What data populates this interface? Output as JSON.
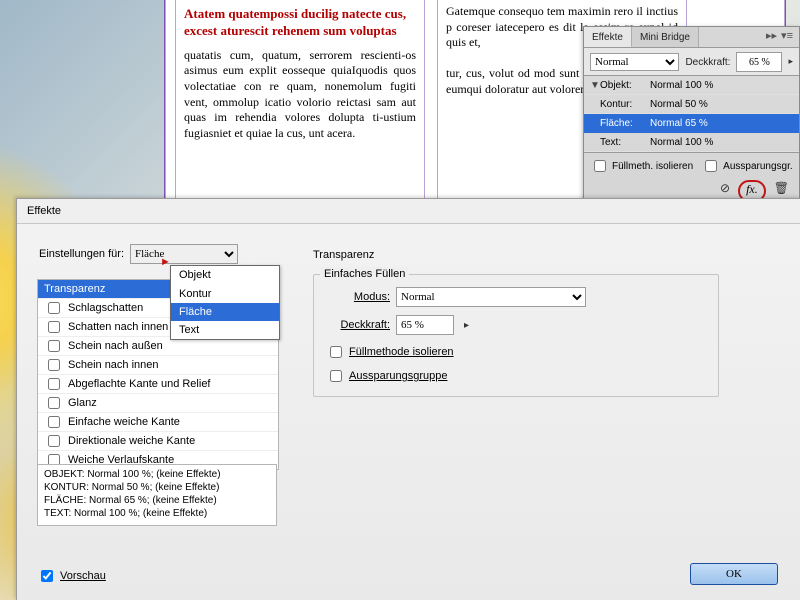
{
  "doc": {
    "heading": "Atatem quatempossi ducilig natecte cus, excest aturescit rehenem sum voluptas",
    "col1": "quatatis cum, quatum, serrorem rescienti-os asimus eum explit eosseque quiaIquodis quos volectatiae con re quam, nonemolum fugiti vent, ommolup icatio volorio reictasi sam aut quas im rehendia volores dolupta ti-ustium fugiasniet et quiae la cus, unt acera.",
    "col2": "Gatemque consequo tem maximin rero il inctius p coreser iatecepero es dit la essim re expel id quis et,\n\ntur, cus, volut od mod sunt veleseq uatio. Nam eumqui doloratur aut volorem in in eatem"
  },
  "panel": {
    "tab_active": "Effekte",
    "tab_other": "Mini Bridge",
    "mode_value": "Normal",
    "opacity_label": "Deckkraft:",
    "opacity_value": "65 %",
    "rows": [
      {
        "name": "Objekt:",
        "info": "Normal 100 %",
        "selected": false,
        "tri": "▼"
      },
      {
        "name": "Kontur:",
        "info": "Normal 50 %",
        "selected": false,
        "tri": ""
      },
      {
        "name": "Fläche:",
        "info": "Normal 65 %",
        "selected": true,
        "tri": ""
      },
      {
        "name": "Text:",
        "info": "Normal 100 %",
        "selected": false,
        "tri": ""
      }
    ],
    "isolate": "Füllmeth. isolieren",
    "knockout": "Aussparungsgr.",
    "fx_label": "fx."
  },
  "dialog": {
    "title": "Effekte",
    "settings_for": "Einstellungen für:",
    "settings_value": "Fläche",
    "dropdown": [
      "Objekt",
      "Kontur",
      "Fläche",
      "Text"
    ],
    "dropdown_selected": "Fläche",
    "effects": [
      {
        "label": "Transparenz",
        "check": false,
        "selected": true,
        "hide_check": true
      },
      {
        "label": "Schlagschatten",
        "check": false
      },
      {
        "label": "Schatten nach innen",
        "check": false
      },
      {
        "label": "Schein nach außen",
        "check": false
      },
      {
        "label": "Schein nach innen",
        "check": false
      },
      {
        "label": "Abgeflachte Kante und Relief",
        "check": false
      },
      {
        "label": "Glanz",
        "check": false
      },
      {
        "label": "Einfache weiche Kante",
        "check": false
      },
      {
        "label": "Direktionale weiche Kante",
        "check": false
      },
      {
        "label": "Weiche Verlaufskante",
        "check": false
      }
    ],
    "summary": [
      "OBJEKT: Normal 100 %; (keine Effekte)",
      "KONTUR: Normal 50 %; (keine Effekte)",
      "FLÄCHE: Normal 65 %; (keine Effekte)",
      "TEXT: Normal 100 %; (keine Effekte)"
    ],
    "right_title": "Transparenz",
    "group_legend": "Einfaches Füllen",
    "mode_label": "Modus:",
    "mode_value": "Normal",
    "opacity_label": "Deckkraft:",
    "opacity_value": "65 %",
    "iso": "Füllmethode isolieren",
    "knock": "Aussparungsgruppe",
    "preview": "Vorschau",
    "ok": "OK"
  }
}
